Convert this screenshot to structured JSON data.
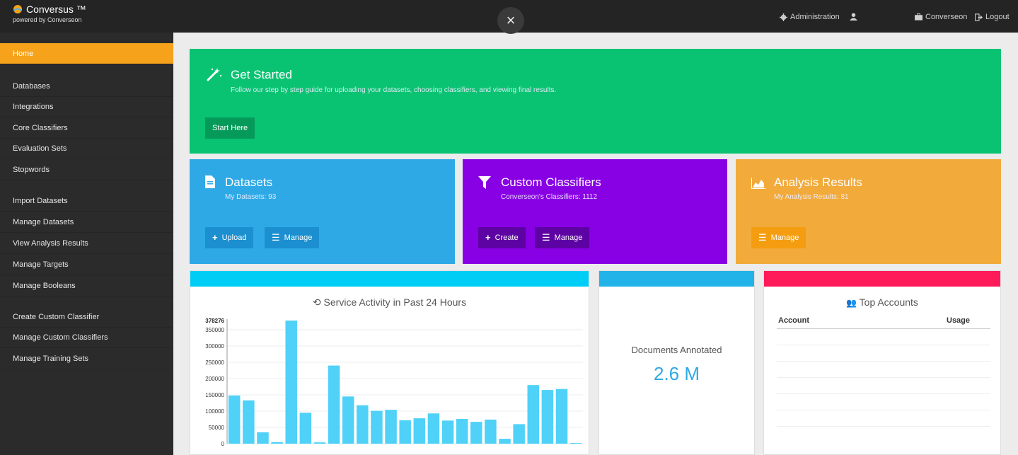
{
  "app": {
    "title": "Conversus ™",
    "subtitle": "powered by Converseon"
  },
  "topbar": {
    "close_glyph": "×",
    "admin_label": "Administration",
    "org_label": "Converseon",
    "logout_label": "Logout"
  },
  "icons": {
    "admin": "gear-icon",
    "user": "user-icon",
    "org": "briefcase-icon",
    "logout": "logout-icon",
    "close": "close-icon"
  },
  "sidebar": {
    "items": [
      {
        "label": "Home",
        "active": true
      },
      {
        "label": "Databases"
      },
      {
        "label": "Integrations"
      },
      {
        "label": "Core Classifiers"
      },
      {
        "label": "Evaluation Sets"
      },
      {
        "label": "Stopwords"
      },
      {
        "label": "Import Datasets"
      },
      {
        "label": "Manage Datasets"
      },
      {
        "label": "View Analysis Results"
      },
      {
        "label": "Manage Targets"
      },
      {
        "label": "Manage Booleans"
      },
      {
        "label": "Create Custom Classifier"
      },
      {
        "label": "Manage Custom Classifiers"
      },
      {
        "label": "Manage Training Sets"
      }
    ]
  },
  "get_started": {
    "title": "Get Started",
    "description": "Follow our step by step guide for uploading your datasets, choosing classifiers, and viewing final results.",
    "button": "Start Here"
  },
  "datasets": {
    "title": "Datasets",
    "subtitle": "My Datasets: 93",
    "upload": "Upload",
    "manage": "Manage"
  },
  "classifiers": {
    "title": "Custom Classifiers",
    "subtitle": "Converseon's Classifiers: 1112",
    "create": "Create",
    "manage": "Manage"
  },
  "analysis": {
    "title": "Analysis Results",
    "subtitle": "My Analysis Results: 81",
    "manage": "Manage"
  },
  "activity": {
    "title": "Service Activity in Past 24 Hours"
  },
  "documents": {
    "label": "Documents Annotated",
    "value": "2.6 M"
  },
  "accounts": {
    "title": "Top Accounts",
    "col_account": "Account",
    "col_usage": "Usage"
  },
  "colors": {
    "green": "#09c372",
    "blue": "#2ea9e6",
    "purple": "#8800e4",
    "orange": "#f2aa3b",
    "cyan_band": "#00cdf5",
    "pink_band": "#ff1b5a",
    "bar": "#4fd1f8",
    "sidebar_active": "#f6a21a"
  },
  "chart_data": {
    "type": "bar",
    "categories": [],
    "values": [
      148000,
      133000,
      35000,
      5000,
      378276,
      95000,
      4000,
      240000,
      145000,
      118000,
      101000,
      104000,
      72000,
      78000,
      93000,
      71000,
      76000,
      67000,
      74000,
      15000,
      60000,
      180000,
      165000,
      168000,
      2000
    ],
    "max_label": "378276",
    "ylim": [
      0,
      378276
    ],
    "yticks": [
      0,
      50000,
      100000,
      150000,
      200000,
      250000,
      300000,
      350000
    ],
    "grid": true
  }
}
